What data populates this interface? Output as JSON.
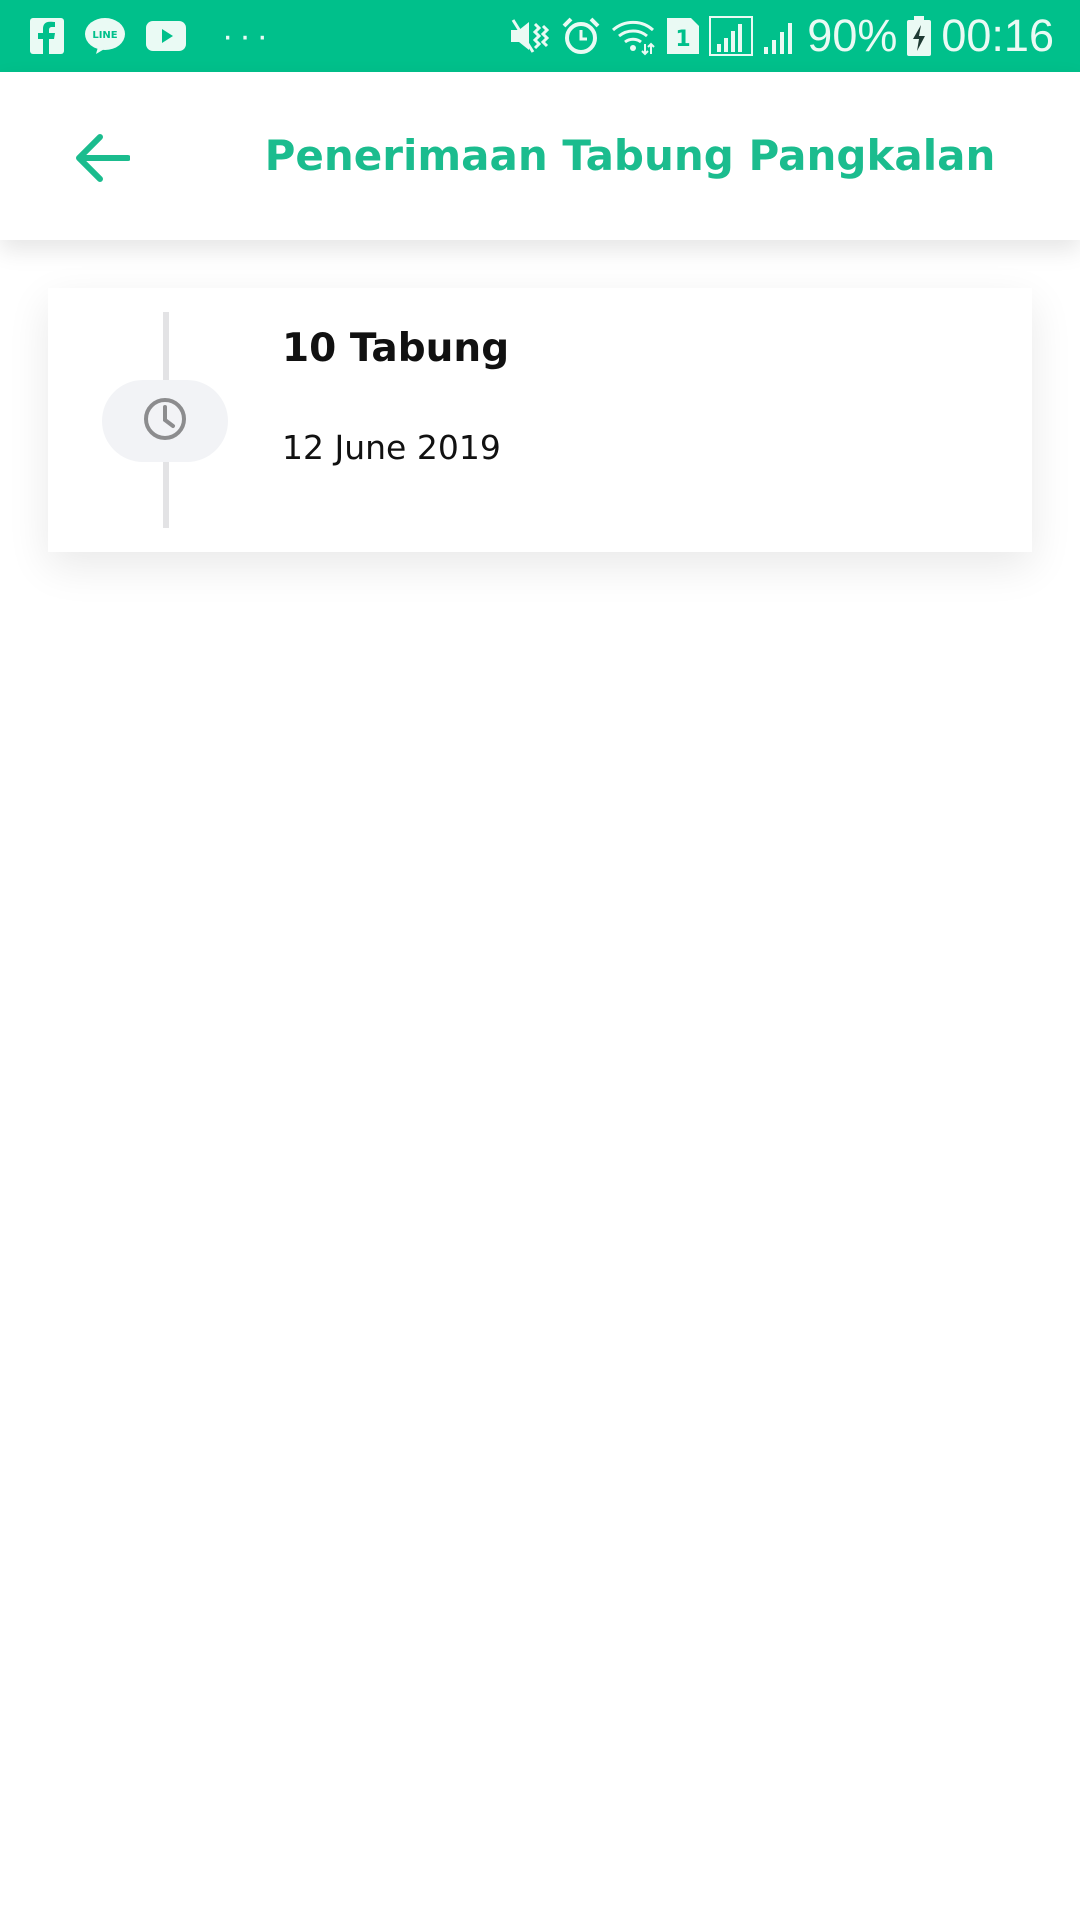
{
  "status_bar": {
    "left_icons": [
      "facebook-icon",
      "line-icon",
      "youtube-icon"
    ],
    "more_indicator": "···",
    "right_icons": [
      "vibrate-icon",
      "alarm-icon",
      "wifi-icon",
      "sim-1-icon",
      "signal-icon",
      "signal-2-icon",
      "battery-charging-icon"
    ],
    "battery_text": "90%",
    "time": "00:16",
    "background_color": "#00c08b"
  },
  "app_bar": {
    "back_icon": "arrow-left-icon",
    "title": "Penerimaan Tabung Pangkalan",
    "accent_color": "#1bbc8e"
  },
  "history": {
    "items": [
      {
        "icon": "clock-icon",
        "title": "10 Tabung",
        "date": "12 June 2019"
      }
    ]
  }
}
